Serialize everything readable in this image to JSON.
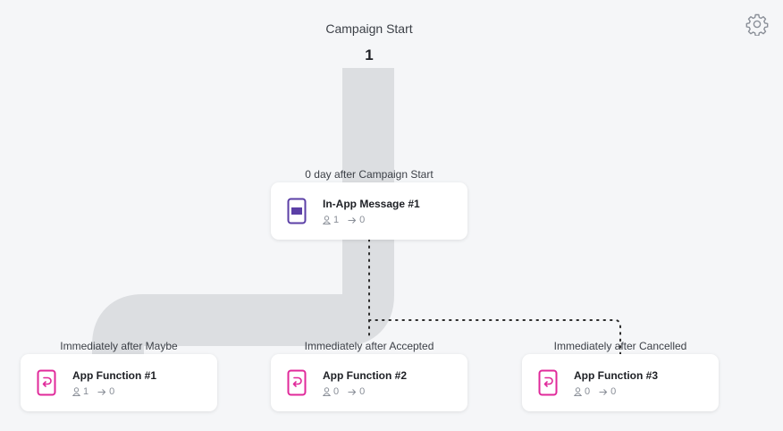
{
  "campaign": {
    "start_label": "Campaign Start",
    "start_count": "1"
  },
  "settings": {
    "icon": "gear-icon"
  },
  "steps": [
    {
      "timing": "0 day after Campaign Start",
      "title": "In-App Message #1",
      "icon": "phone-message-icon",
      "users": "1",
      "conversions": "0",
      "color": "#5b3fa6"
    },
    {
      "timing": "Immediately after Maybe",
      "title": "App Function #1",
      "icon": "app-function-icon",
      "users": "1",
      "conversions": "0",
      "color": "#e0299a"
    },
    {
      "timing": "Immediately after Accepted",
      "title": "App Function #2",
      "icon": "app-function-icon",
      "users": "0",
      "conversions": "0",
      "color": "#e0299a"
    },
    {
      "timing": "Immediately after Cancelled",
      "title": "App Function #3",
      "icon": "app-function-icon",
      "users": "0",
      "conversions": "0",
      "color": "#e0299a"
    }
  ],
  "colors": {
    "flow": "#dcdee1",
    "background": "#f5f6f8",
    "dots": "#2b2b2b"
  }
}
